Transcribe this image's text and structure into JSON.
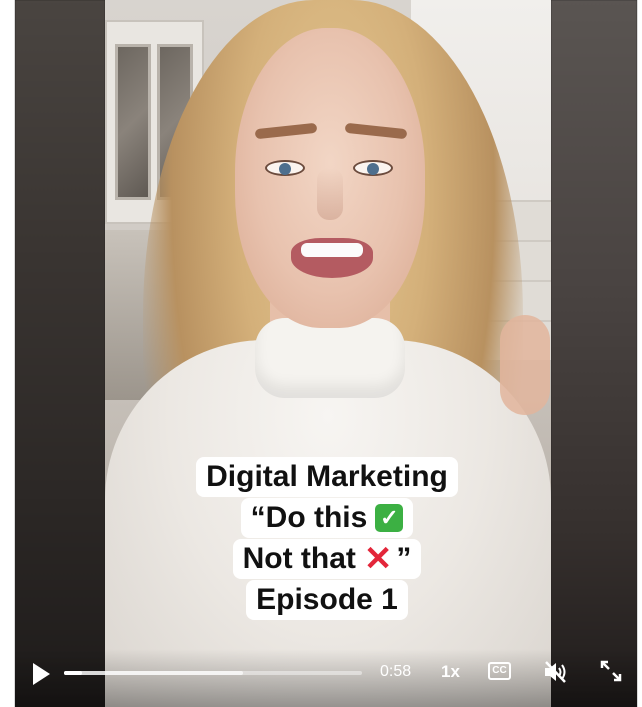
{
  "caption": {
    "line1": "Digital Marketing",
    "line2": "“Do this",
    "line3": "Not that",
    "line3_end": "”",
    "line4": "Episode 1"
  },
  "controls": {
    "time": "0:58",
    "speed": "1x",
    "cc_label": "CC",
    "progress": 0.06,
    "buffered": 0.6
  },
  "icons": {
    "play": "play-icon",
    "check": "check-mark-icon",
    "cross": "cross-mark-icon",
    "captions": "closed-captions-icon",
    "mute": "speaker-muted-icon",
    "fullscreen": "expand-icon"
  },
  "colors": {
    "check": "#3cb043",
    "cross": "#e3263a"
  }
}
